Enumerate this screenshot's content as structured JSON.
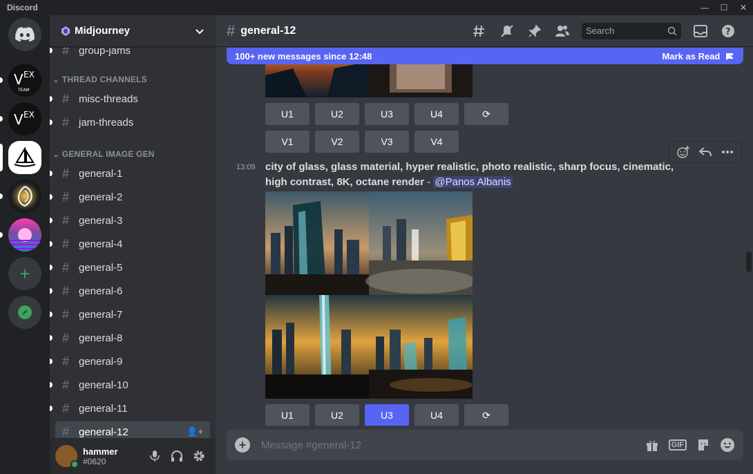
{
  "app": {
    "brand": "Discord"
  },
  "window_controls": {
    "minimize": "—",
    "maximize": "☐",
    "close": "✕"
  },
  "server": {
    "name": "Midjourney"
  },
  "categories": [
    {
      "label": "THREAD CHANNELS"
    },
    {
      "label": "GENERAL IMAGE GEN"
    }
  ],
  "channels": {
    "group_jams": "group-jams",
    "misc_threads": "misc-threads",
    "jam_threads": "jam-threads",
    "general": [
      "general-1",
      "general-2",
      "general-3",
      "general-4",
      "general-5",
      "general-6",
      "general-7",
      "general-8",
      "general-9",
      "general-10",
      "general-11",
      "general-12"
    ]
  },
  "user": {
    "name": "hammer",
    "tag": "#0620"
  },
  "header": {
    "channel": "general-12",
    "search_placeholder": "Search"
  },
  "new_messages": {
    "text": "100+ new messages since 12:48",
    "action": "Mark as Read"
  },
  "message": {
    "time": "13:09",
    "prompt": "city of glass, glass material, hyper realistic, photo realistic, sharp focus, cinematic, high contrast, 8K, octane render",
    "separator": " - ",
    "mention": "@Panos Albanis"
  },
  "buttons": {
    "u": [
      "U1",
      "U2",
      "U3",
      "U4"
    ],
    "v": [
      "V1",
      "V2",
      "V3",
      "V4"
    ],
    "refresh": "⟳"
  },
  "composer": {
    "placeholder": "Message #general-12",
    "gif": "GIF"
  },
  "colors": {
    "blurple": "#5865f2",
    "green": "#3ba55d"
  }
}
